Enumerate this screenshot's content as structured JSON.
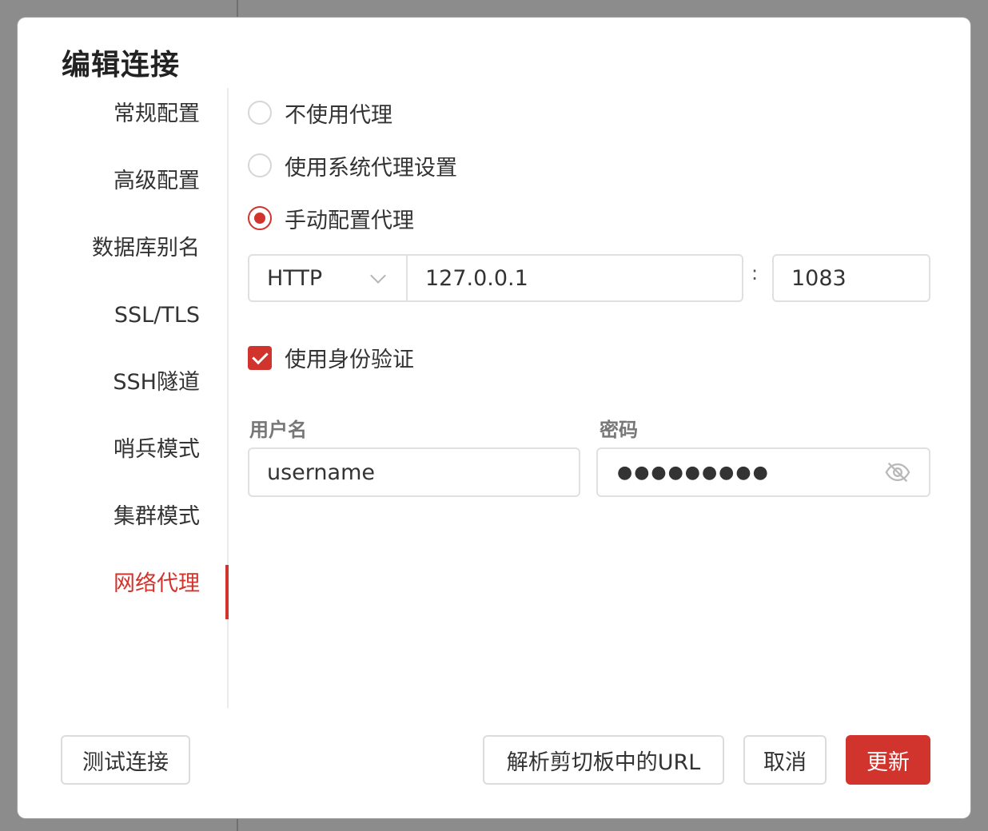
{
  "dialog": {
    "title": "编辑连接"
  },
  "sidebar": {
    "items": [
      {
        "label": "常规配置"
      },
      {
        "label": "高级配置"
      },
      {
        "label": "数据库别名"
      },
      {
        "label": "SSL/TLS"
      },
      {
        "label": "SSH隧道"
      },
      {
        "label": "哨兵模式"
      },
      {
        "label": "集群模式"
      },
      {
        "label": "网络代理",
        "active": true
      }
    ]
  },
  "proxy": {
    "options": [
      {
        "label": "不使用代理",
        "checked": false
      },
      {
        "label": "使用系统代理设置",
        "checked": false
      },
      {
        "label": "手动配置代理",
        "checked": true
      }
    ],
    "protocol": "HTTP",
    "host": "127.0.0.1",
    "separator": ":",
    "port": "1083",
    "auth": {
      "label": "使用身份验证",
      "checked": true,
      "username_label": "用户名",
      "username": "username",
      "password_label": "密码",
      "password_mask": "●●●●●●●●●"
    }
  },
  "footer": {
    "test_label": "测试连接",
    "parse_label": "解析剪切板中的URL",
    "cancel_label": "取消",
    "update_label": "更新"
  },
  "colors": {
    "accent": "#d0342c",
    "border": "#e0e0e0",
    "text": "#333333"
  },
  "icons": {
    "password_toggle": "eye-off-icon",
    "protocol_dropdown": "chevron-down-icon"
  }
}
